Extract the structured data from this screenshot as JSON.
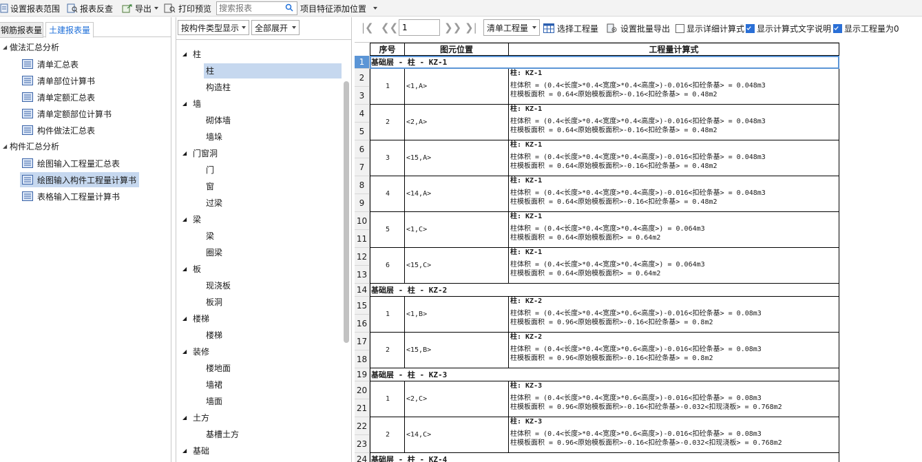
{
  "toolbar": {
    "set_range": "设置报表范围",
    "report_check": "报表反查",
    "export": "导出",
    "print_preview": "打印预览",
    "search_placeholder": "搜索报表",
    "feature_position": "项目特征添加位置"
  },
  "left": {
    "tabs": [
      "钢筋报表量",
      "土建报表量"
    ],
    "active_tab": "土建报表量",
    "groups": [
      {
        "label": "做法汇总分析",
        "items": [
          "清单汇总表",
          "清单部位计算书",
          "清单定额汇总表",
          "清单定额部位计算书",
          "构件做法汇总表"
        ]
      },
      {
        "label": "构件汇总分析",
        "items": [
          "绘图输入工程量汇总表",
          "绘图输入构件工程量计算书",
          "表格输入工程量计算书"
        ]
      }
    ],
    "selected_item": "绘图输入构件工程量计算书"
  },
  "middle": {
    "display_mode": "按构件类型显示",
    "expand_mode": "全部展开",
    "tree": [
      {
        "label": "柱",
        "children": [
          "柱",
          "构造柱"
        ]
      },
      {
        "label": "墙",
        "children": [
          "砌体墙",
          "墙垛"
        ]
      },
      {
        "label": "门窗洞",
        "children": [
          "门",
          "窗",
          "过梁"
        ]
      },
      {
        "label": "梁",
        "children": [
          "梁",
          "圈梁"
        ]
      },
      {
        "label": "板",
        "children": [
          "现浇板",
          "板洞"
        ]
      },
      {
        "label": "楼梯",
        "children": [
          "楼梯"
        ]
      },
      {
        "label": "装修",
        "children": [
          "楼地面",
          "墙裙",
          "墙面"
        ]
      },
      {
        "label": "土方",
        "children": [
          "基槽土方"
        ]
      },
      {
        "label": "基础",
        "children": []
      }
    ],
    "selected": "柱"
  },
  "right_toolbar": {
    "page": "1",
    "quantity_type": "清单工程量",
    "select_quantity": "选择工程量",
    "set_batch_export": "设置批量导出",
    "show_detail_formula": "显示详细计算式",
    "show_formula_text": "显示计算式文字说明",
    "show_zero_quantity": "显示工程量为0",
    "checks": {
      "detail": false,
      "text": true,
      "zero": true
    }
  },
  "report": {
    "headers": [
      "序号",
      "图元位置",
      "工程量计算式"
    ],
    "row_numbers": [
      "1",
      "2",
      "3",
      "4",
      "5",
      "6",
      "7",
      "8",
      "9",
      "10",
      "11",
      "12",
      "13",
      "14",
      "15",
      "16",
      "17",
      "18",
      "19",
      "20",
      "21",
      "22",
      "23",
      "24"
    ],
    "sections": [
      {
        "band": "基础层 - 柱 - KZ-1",
        "rows": [
          {
            "seq": "1",
            "loc": "<1,A>",
            "title": "柱: KZ-1",
            "line1": "柱体积 = (0.4<长度>*0.4<宽度>*0.4<高度>)-0.016<扣砼条基> = 0.048m3",
            "line2": "柱模板面积 = 0.64<原始模板面积>-0.16<扣砼条基> = 0.48m2"
          },
          {
            "seq": "2",
            "loc": "<2,A>",
            "title": "柱: KZ-1",
            "line1": "柱体积 = (0.4<长度>*0.4<宽度>*0.4<高度>)-0.016<扣砼条基> = 0.048m3",
            "line2": "柱模板面积 = 0.64<原始模板面积>-0.16<扣砼条基> = 0.48m2"
          },
          {
            "seq": "3",
            "loc": "<15,A>",
            "title": "柱: KZ-1",
            "line1": "柱体积 = (0.4<长度>*0.4<宽度>*0.4<高度>)-0.016<扣砼条基> = 0.048m3",
            "line2": "柱模板面积 = 0.64<原始模板面积>-0.16<扣砼条基> = 0.48m2"
          },
          {
            "seq": "4",
            "loc": "<14,A>",
            "title": "柱: KZ-1",
            "line1": "柱体积 = (0.4<长度>*0.4<宽度>*0.4<高度>)-0.016<扣砼条基> = 0.048m3",
            "line2": "柱模板面积 = 0.64<原始模板面积>-0.16<扣砼条基> = 0.48m2"
          },
          {
            "seq": "5",
            "loc": "<1,C>",
            "title": "柱: KZ-1",
            "line1": "柱体积 = (0.4<长度>*0.4<宽度>*0.4<高度>) = 0.064m3",
            "line2": "柱模板面积 = 0.64<原始模板面积> = 0.64m2"
          },
          {
            "seq": "6",
            "loc": "<15,C>",
            "title": "柱: KZ-1",
            "line1": "柱体积 = (0.4<长度>*0.4<宽度>*0.4<高度>) = 0.064m3",
            "line2": "柱模板面积 = 0.64<原始模板面积> = 0.64m2"
          }
        ]
      },
      {
        "band": "基础层 - 柱 - KZ-2",
        "rows": [
          {
            "seq": "1",
            "loc": "<1,B>",
            "title": "柱: KZ-2",
            "line1": "柱体积 = (0.4<长度>*0.4<宽度>*0.6<高度>)-0.016<扣砼条基> = 0.08m3",
            "line2": "柱模板面积 = 0.96<原始模板面积>-0.16<扣砼条基> = 0.8m2"
          },
          {
            "seq": "2",
            "loc": "<15,B>",
            "title": "柱: KZ-2",
            "line1": "柱体积 = (0.4<长度>*0.4<宽度>*0.6<高度>)-0.016<扣砼条基> = 0.08m3",
            "line2": "柱模板面积 = 0.96<原始模板面积>-0.16<扣砼条基> = 0.8m2"
          }
        ]
      },
      {
        "band": "基础层 - 柱 - KZ-3",
        "rows": [
          {
            "seq": "1",
            "loc": "<2,C>",
            "title": "柱: KZ-3",
            "line1": "柱体积 = (0.4<长度>*0.4<宽度>*0.6<高度>)-0.016<扣砼条基> = 0.08m3",
            "line2": "柱模板面积 = 0.96<原始模板面积>-0.16<扣砼条基>-0.032<扣现浇板> = 0.768m2"
          },
          {
            "seq": "2",
            "loc": "<14,C>",
            "title": "柱: KZ-3",
            "line1": "柱体积 = (0.4<长度>*0.4<宽度>*0.6<高度>)-0.016<扣砼条基> = 0.08m3",
            "line2": "柱模板面积 = 0.96<原始模板面积>-0.16<扣砼条基>-0.032<扣现浇板> = 0.768m2"
          }
        ]
      },
      {
        "band": "基础层 - 柱 - KZ-4",
        "rows": []
      }
    ]
  }
}
